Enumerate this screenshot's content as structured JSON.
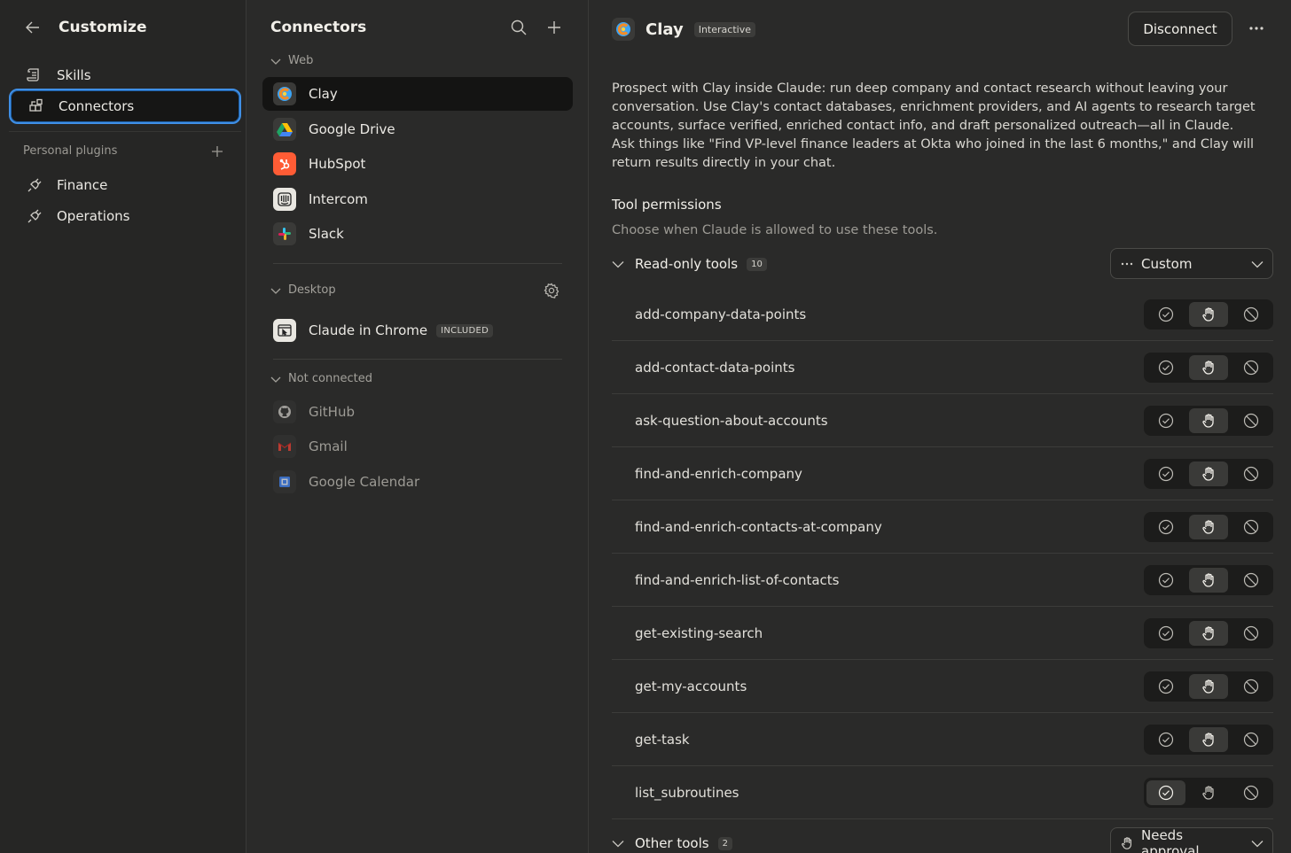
{
  "left": {
    "title": "Customize",
    "nav": [
      {
        "label": "Skills",
        "icon": "skills-scroll-icon"
      },
      {
        "label": "Connectors",
        "icon": "connectors-grid-icon",
        "active": true
      }
    ],
    "plugins_label": "Personal plugins",
    "plugins": [
      {
        "label": "Finance",
        "icon": "plug-icon"
      },
      {
        "label": "Operations",
        "icon": "plug-icon"
      }
    ]
  },
  "middle": {
    "title": "Connectors",
    "groups": {
      "web": {
        "label": "Web",
        "items": [
          {
            "label": "Clay",
            "icon": "clay-logo-icon",
            "active": true
          },
          {
            "label": "Google Drive",
            "icon": "google-drive-logo-icon"
          },
          {
            "label": "HubSpot",
            "icon": "hubspot-logo-icon"
          },
          {
            "label": "Intercom",
            "icon": "intercom-logo-icon"
          },
          {
            "label": "Slack",
            "icon": "slack-logo-icon"
          }
        ]
      },
      "desktop": {
        "label": "Desktop",
        "items": [
          {
            "label": "Claude in Chrome",
            "badge": "INCLUDED",
            "icon": "chrome-extension-icon"
          }
        ]
      },
      "not_connected": {
        "label": "Not connected",
        "items": [
          {
            "label": "GitHub",
            "icon": "github-logo-icon"
          },
          {
            "label": "Gmail",
            "icon": "gmail-logo-icon"
          },
          {
            "label": "Google Calendar",
            "icon": "google-calendar-logo-icon"
          }
        ]
      }
    }
  },
  "detail": {
    "name": "Clay",
    "badge": "Interactive",
    "disconnect_label": "Disconnect",
    "description": "Prospect with Clay inside Claude: run deep company and contact research without leaving your conversation. Use Clay's contact databases, enrichment providers, and AI agents to research target accounts, surface verified, enriched contact info, and draft personalized outreach—all in Claude. Ask things like \"Find VP-level finance leaders at Okta who joined in the last 6 months,\" and Clay will return results directly in your chat.",
    "permissions_title": "Tool permissions",
    "permissions_subtitle": "Choose when Claude is allowed to use these tools.",
    "read_only": {
      "label": "Read-only tools",
      "count": "10",
      "setting": "Custom"
    },
    "tools": [
      {
        "name": "add-company-data-points",
        "permission": "needs-approval"
      },
      {
        "name": "add-contact-data-points",
        "permission": "needs-approval"
      },
      {
        "name": "ask-question-about-accounts",
        "permission": "needs-approval"
      },
      {
        "name": "find-and-enrich-company",
        "permission": "needs-approval"
      },
      {
        "name": "find-and-enrich-contacts-at-company",
        "permission": "needs-approval"
      },
      {
        "name": "find-and-enrich-list-of-contacts",
        "permission": "needs-approval"
      },
      {
        "name": "get-existing-search",
        "permission": "needs-approval"
      },
      {
        "name": "get-my-accounts",
        "permission": "needs-approval"
      },
      {
        "name": "get-task",
        "permission": "needs-approval"
      },
      {
        "name": "list_subroutines",
        "permission": "always-allow"
      }
    ],
    "other": {
      "label": "Other tools",
      "count": "2",
      "setting": "Needs approval"
    }
  },
  "colors": {
    "accent_focus": "#3f8fe6",
    "background": "#2a2a29",
    "sidebar": "#262625",
    "hubspot": "#ff5c35",
    "clay_orange": "#f28c28",
    "clay_blue": "#3ba4f5"
  }
}
